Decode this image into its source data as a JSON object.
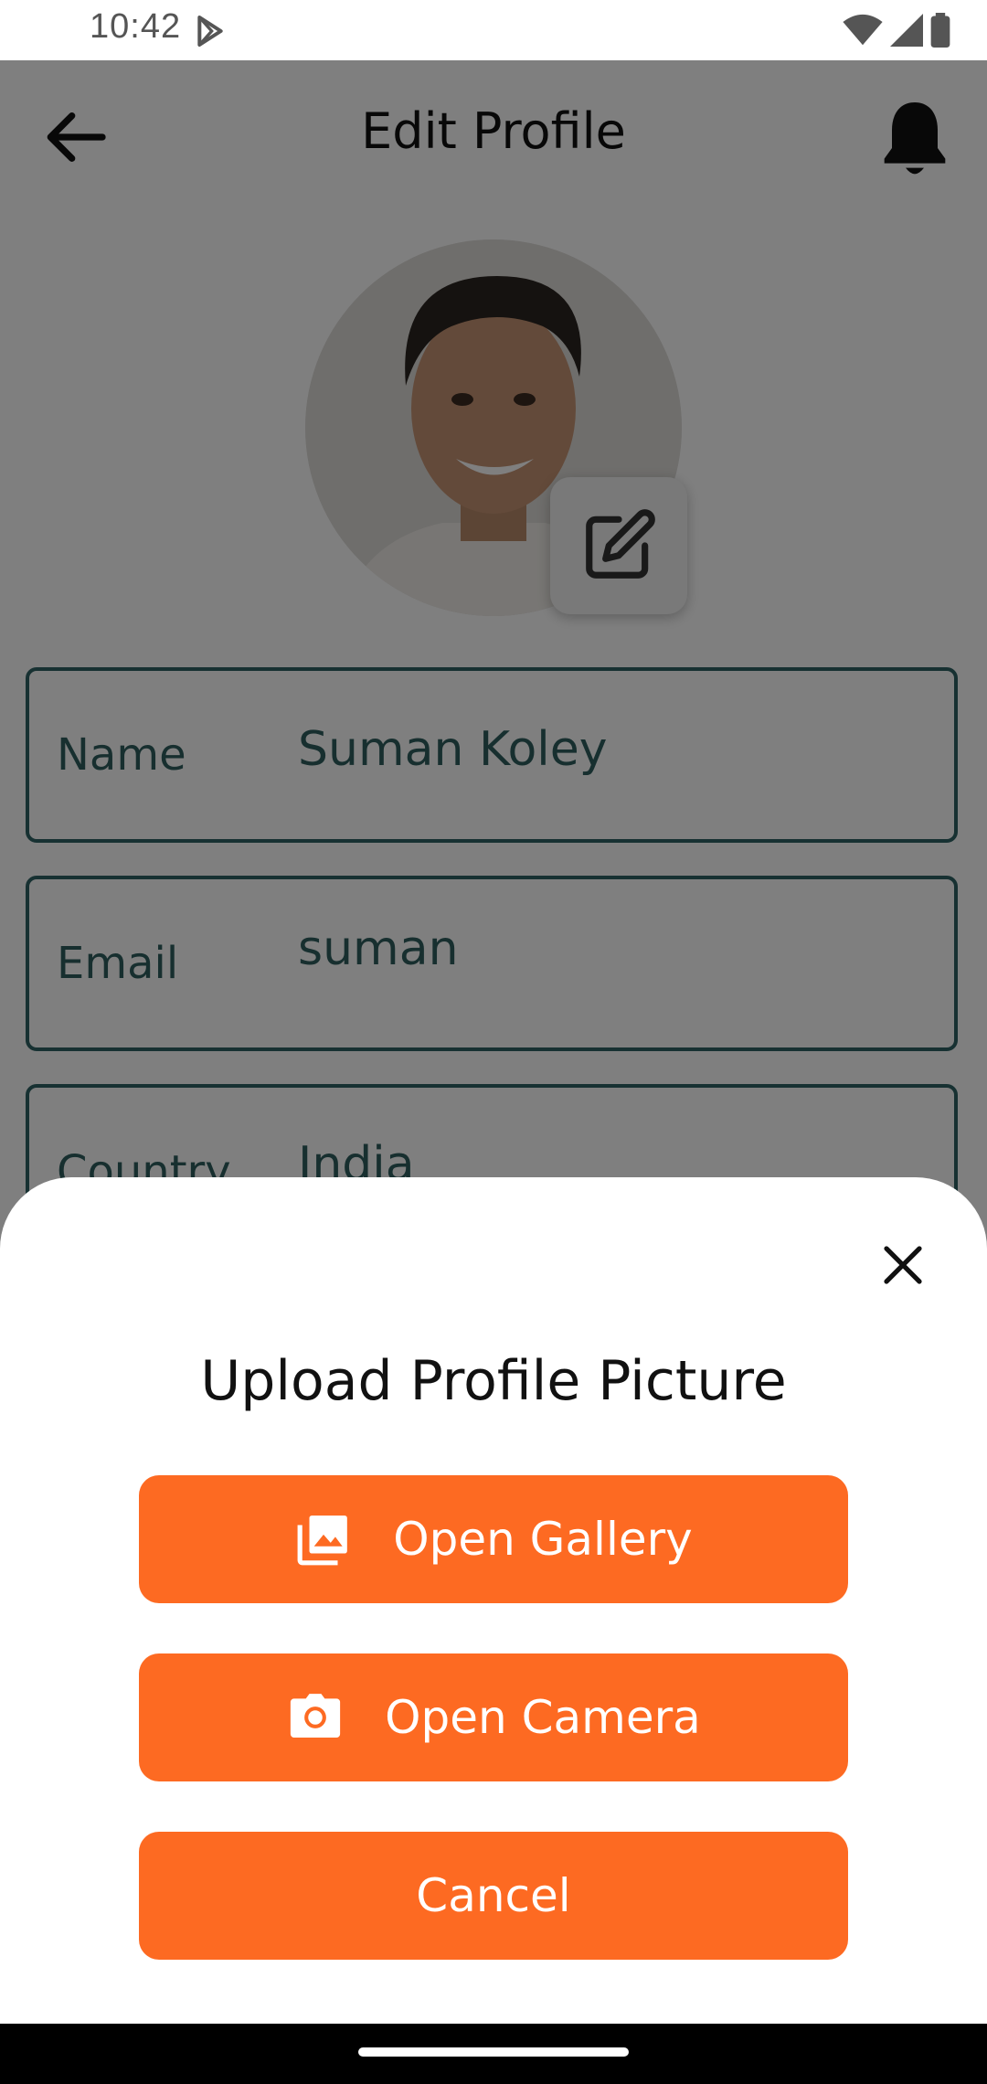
{
  "status": {
    "time": "10:42"
  },
  "header": {
    "title": "Edit Profile"
  },
  "form": {
    "fields": [
      {
        "label": "Name",
        "value": "Suman Koley"
      },
      {
        "label": "Email",
        "value": "suman"
      },
      {
        "label": "Country",
        "value": "India"
      }
    ]
  },
  "sheet": {
    "title": "Upload Profile Picture",
    "gallery_label": "Open Gallery",
    "camera_label": "Open Camera",
    "cancel_label": "Cancel"
  },
  "colors": {
    "accent": "#fd6a22",
    "field_border": "#2f6364",
    "field_text": "#2f5f5f"
  },
  "icons": [
    "back-arrow-icon",
    "bell-icon",
    "edit-icon",
    "close-icon",
    "gallery-icon",
    "camera-icon",
    "play-store-icon",
    "wifi-icon",
    "signal-icon",
    "battery-icon"
  ]
}
